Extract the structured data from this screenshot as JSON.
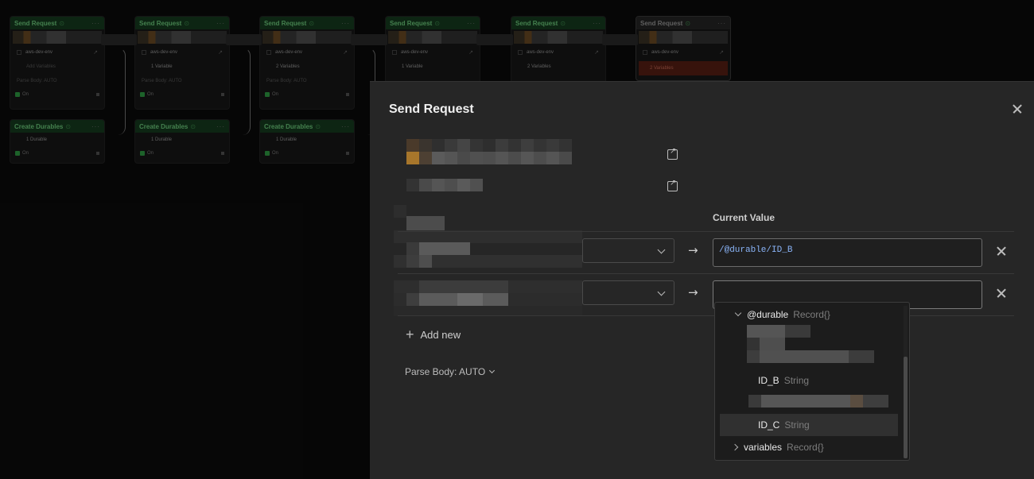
{
  "canvas": {
    "nodes": [
      {
        "title": "Send Request",
        "env": "aws-dev-env",
        "vars": "Add Variables",
        "parse": "Parse Body: AUTO",
        "status": "On"
      },
      {
        "title": "Send Request",
        "env": "aws-dev-env",
        "vars": "1 Variable",
        "parse": "Parse Body: AUTO",
        "status": "On"
      },
      {
        "title": "Send Request",
        "env": "aws-dev-env",
        "vars": "2 Variables",
        "parse": "Parse Body: AUTO",
        "status": "On"
      },
      {
        "title": "Send Request",
        "env": "aws-dev-env",
        "vars": "1 Variable",
        "status": "On"
      },
      {
        "title": "Send Request",
        "env": "aws-dev-env",
        "vars": "2 Variables",
        "status": "On"
      },
      {
        "title": "Send Request",
        "env": "aws-dev-env",
        "vars": "2 Variables"
      }
    ],
    "durables": [
      {
        "title": "Create Durables",
        "count": "1 Durable",
        "status": "On"
      },
      {
        "title": "Create Durables",
        "count": "1 Durable",
        "status": "On"
      },
      {
        "title": "Create Durables",
        "count": "1 Durable",
        "status": "On"
      }
    ],
    "node_menu_glyph": "···"
  },
  "panel": {
    "title": "Send Request",
    "column_header": "Current Value",
    "rows": [
      {
        "value": "/@durable/ID_B"
      },
      {
        "value": ""
      }
    ],
    "add_new_label": "Add new",
    "parse_body_label": "Parse Body: AUTO"
  },
  "dropdown": {
    "group": {
      "key": "@durable",
      "type": "Record{}"
    },
    "items": [
      {
        "key": "ID_B",
        "type": "String"
      },
      {
        "key": "ID_C",
        "type": "String"
      }
    ],
    "collapsed": {
      "key": "variables",
      "type": "Record{}"
    }
  },
  "colors": {
    "accent_green": "#6fcf7f",
    "value_blue": "#8ab4f8",
    "error_red": "#5a1f14"
  }
}
